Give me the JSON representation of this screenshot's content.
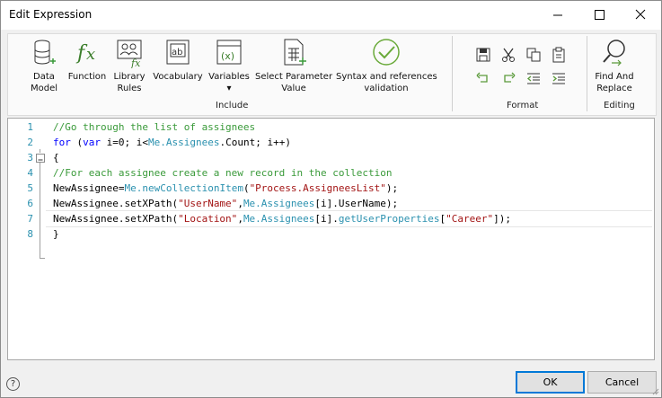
{
  "window": {
    "title": "Edit Expression"
  },
  "titlebar": {
    "minimize_icon": "minimize-icon",
    "maximize_icon": "maximize-icon",
    "close_icon": "close-icon"
  },
  "ribbon": {
    "include": {
      "label": "Include",
      "items": [
        {
          "label": "Data\nModel",
          "icon": "database-add-icon"
        },
        {
          "label": "Function",
          "icon": "fx-icon"
        },
        {
          "label": "Library\nRules",
          "icon": "library-fx-icon"
        },
        {
          "label": "Vocabulary",
          "icon": "vocabulary-ab-icon"
        },
        {
          "label": "Variables\n▾",
          "icon": "variables-x-icon"
        },
        {
          "label": "Select Parameter\nValue",
          "icon": "table-add-icon"
        },
        {
          "label": "Syntax and references\nvalidation",
          "icon": "check-circle-icon"
        }
      ]
    },
    "format": {
      "label": "Format"
    },
    "editing": {
      "label": "Editing",
      "find_label": "Find And\nReplace"
    }
  },
  "editor": {
    "line_numbers": [
      "1",
      "2",
      "3",
      "4",
      "5",
      "6",
      "7",
      "8"
    ],
    "colors": {
      "comment": "#3a9a3a",
      "keyword": "#0000ff",
      "member": "#2b91af",
      "string": "#a31515",
      "plain": "#000000"
    }
  },
  "footer": {
    "ok_label": "OK",
    "cancel_label": "Cancel",
    "help_label": "?"
  }
}
